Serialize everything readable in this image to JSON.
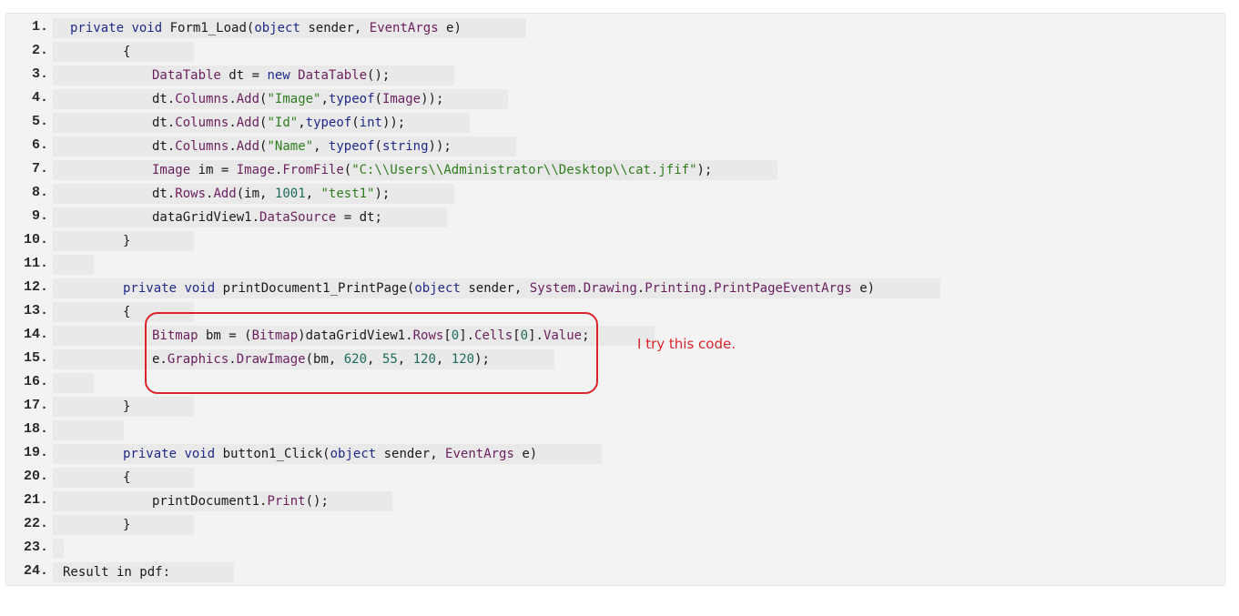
{
  "code_lines": [
    {
      "num": "1.",
      "text": "private void Form1_Load(object sender, EventArgs e)"
    },
    {
      "num": "2.",
      "text": "{"
    },
    {
      "num": "3.",
      "text": "DataTable dt = new DataTable();"
    },
    {
      "num": "4.",
      "text": "dt.Columns.Add(\"Image\",typeof(Image));"
    },
    {
      "num": "5.",
      "text": "dt.Columns.Add(\"Id\",typeof(int));"
    },
    {
      "num": "6.",
      "text": "dt.Columns.Add(\"Name\", typeof(string));"
    },
    {
      "num": "7.",
      "text": "Image im = Image.FromFile(\"C:\\\\Users\\\\Administrator\\\\Desktop\\\\cat.jfif\");"
    },
    {
      "num": "8.",
      "text": "dt.Rows.Add(im, 1001, \"test1\");"
    },
    {
      "num": "9.",
      "text": "dataGridView1.DataSource = dt;"
    },
    {
      "num": "10.",
      "text": "}"
    },
    {
      "num": "11.",
      "text": ""
    },
    {
      "num": "12.",
      "text": "private void printDocument1_PrintPage(object sender, System.Drawing.Printing.PrintPageEventArgs e)"
    },
    {
      "num": "13.",
      "text": "{"
    },
    {
      "num": "14.",
      "text": "Bitmap bm = (Bitmap)dataGridView1.Rows[0].Cells[0].Value;"
    },
    {
      "num": "15.",
      "text": "e.Graphics.DrawImage(bm, 620, 55, 120, 120);"
    },
    {
      "num": "16.",
      "text": ""
    },
    {
      "num": "17.",
      "text": "}"
    },
    {
      "num": "18.",
      "text": ""
    },
    {
      "num": "19.",
      "text": "private void button1_Click(object sender, EventArgs e)"
    },
    {
      "num": "20.",
      "text": "{"
    },
    {
      "num": "21.",
      "text": "printDocument1.Print();"
    },
    {
      "num": "22.",
      "text": "}"
    },
    {
      "num": "23.",
      "text": ""
    },
    {
      "num": "24.",
      "text": "Result in pdf:"
    }
  ],
  "annotation": {
    "text": "I try this code.",
    "color": "#d9262c"
  },
  "colors": {
    "keyword": "#1f2a8a",
    "type": "#6b1f5f",
    "string": "#2e7d1c",
    "number": "#1d6b5c",
    "background": "#f3f3f3"
  }
}
